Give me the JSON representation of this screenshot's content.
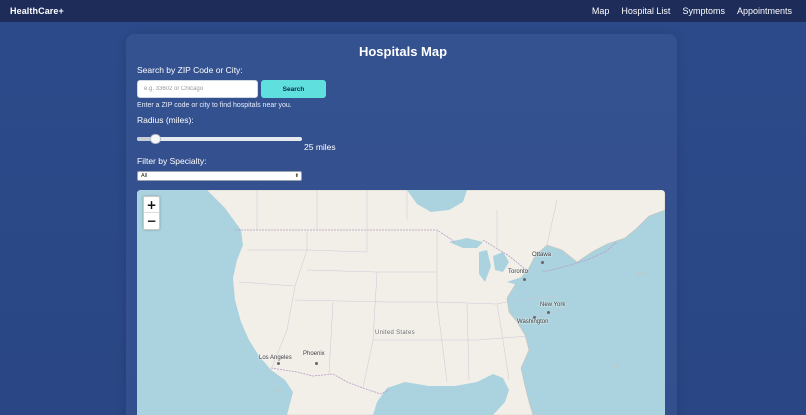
{
  "navbar": {
    "brand": "HealthCare+",
    "links": [
      "Map",
      "Hospital List",
      "Symptoms",
      "Appointments"
    ]
  },
  "page": {
    "title": "Hospitals Map"
  },
  "search": {
    "label": "Search by ZIP Code or City:",
    "value": "",
    "placeholder": "e.g. 33602 or Chicago",
    "button_label": "Search",
    "hint": "Enter a ZIP code or city to find hospitals near you."
  },
  "radius": {
    "label": "Radius (miles):",
    "value": 25,
    "fraction": 0.07,
    "display": "25 miles"
  },
  "specialty": {
    "label": "Filter by Specialty:",
    "selected": "All"
  },
  "map": {
    "zoom_in": "+",
    "zoom_out": "−",
    "country_label": "United States",
    "cities": {
      "ottawa": "Ottawa",
      "toronto": "Toronto",
      "new_york": "New York",
      "washington": "Washington",
      "los_angeles": "Los Angeles",
      "phoenix": "Phoenix"
    }
  },
  "colors": {
    "accent": "#5fe0df",
    "navbar": "#1d2c59",
    "background": "#2c4a8a",
    "water": "#aad3df",
    "land": "#f2efe9"
  }
}
